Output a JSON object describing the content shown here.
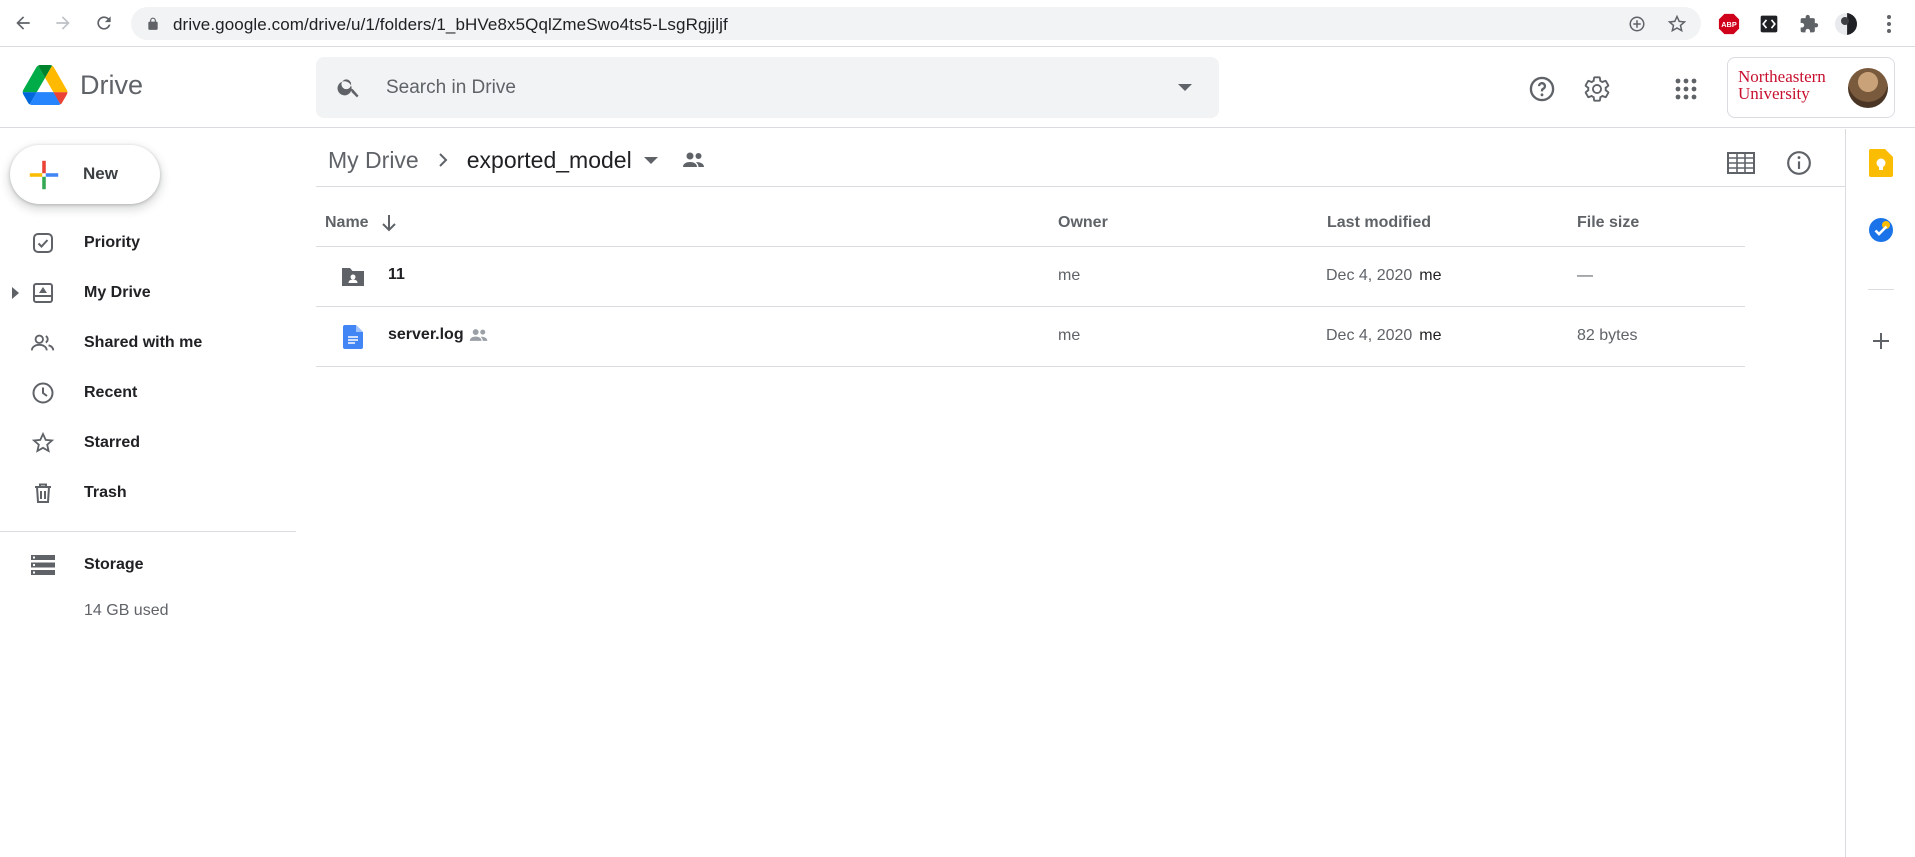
{
  "browser": {
    "url": "drive.google.com/drive/u/1/folders/1_bHVe8x5QqlZmeSwo4ts5-LsgRgjjljf",
    "extensions": [
      "adblock-icon",
      "code-extension-icon",
      "puzzle-icon",
      "profile-icon"
    ]
  },
  "header": {
    "app_name": "Drive",
    "search_placeholder": "Search in Drive",
    "org_name_line1": "Northeastern",
    "org_name_line2": "University"
  },
  "sidebar": {
    "new_label": "New",
    "items": [
      {
        "label": "Priority",
        "icon": "priority-icon"
      },
      {
        "label": "My Drive",
        "icon": "my-drive-icon"
      },
      {
        "label": "Shared with me",
        "icon": "shared-icon"
      },
      {
        "label": "Recent",
        "icon": "clock-icon"
      },
      {
        "label": "Starred",
        "icon": "star-icon"
      },
      {
        "label": "Trash",
        "icon": "trash-icon"
      }
    ],
    "storage_label": "Storage",
    "storage_used": "14 GB used"
  },
  "breadcrumb": {
    "root": "My Drive",
    "current": "exported_model"
  },
  "table": {
    "headers": {
      "name": "Name",
      "owner": "Owner",
      "last_modified": "Last modified",
      "file_size": "File size"
    },
    "rows": [
      {
        "name": "11",
        "type": "shared-folder-icon",
        "owner": "me",
        "modified_date": "Dec 4, 2020",
        "modified_by": "me",
        "size": "—"
      },
      {
        "name": "server.log",
        "type": "doc-icon",
        "owner": "me",
        "modified_date": "Dec 4, 2020",
        "modified_by": "me",
        "size": "82 bytes"
      }
    ]
  },
  "colors": {
    "accent_blue": "#1a73e8",
    "keep_yellow": "#fbbc04",
    "nu_red": "#c8102e"
  }
}
